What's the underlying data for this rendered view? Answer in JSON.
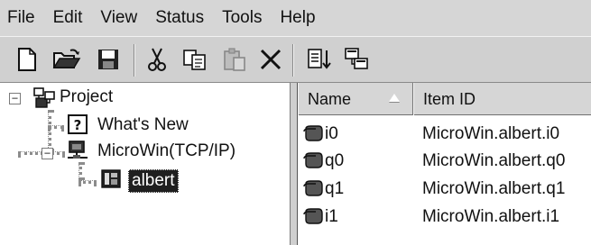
{
  "menu": {
    "items": [
      "File",
      "Edit",
      "View",
      "Status",
      "Tools",
      "Help"
    ]
  },
  "toolbar": {
    "buttons": [
      {
        "name": "new-icon"
      },
      {
        "name": "open-folder-icon"
      },
      {
        "name": "save-icon"
      },
      {
        "name": "cut-icon"
      },
      {
        "name": "copy-icon"
      },
      {
        "name": "paste-icon",
        "disabled": true
      },
      {
        "name": "delete-icon"
      },
      {
        "name": "sort-list-icon"
      },
      {
        "name": "browse-network-icon"
      }
    ]
  },
  "tree": {
    "root": {
      "label": "Project",
      "expander": "−",
      "icon": "project-network-icon"
    },
    "children": [
      {
        "label": "What's New",
        "icon": "help-question-icon"
      },
      {
        "label": "MicroWin(TCP/IP)",
        "expander": "−",
        "icon": "computer-network-icon",
        "children": [
          {
            "label": "albert",
            "icon": "plc-station-icon",
            "selected": true
          }
        ]
      }
    ]
  },
  "list": {
    "columns": [
      "Name",
      "Item ID"
    ],
    "sort_column": "Name",
    "rows": [
      {
        "name": "i0",
        "item_id": "MicroWin.albert.i0"
      },
      {
        "name": "q0",
        "item_id": "MicroWin.albert.q0"
      },
      {
        "name": "q1",
        "item_id": "MicroWin.albert.q1"
      },
      {
        "name": "i1",
        "item_id": "MicroWin.albert.i1"
      }
    ]
  }
}
